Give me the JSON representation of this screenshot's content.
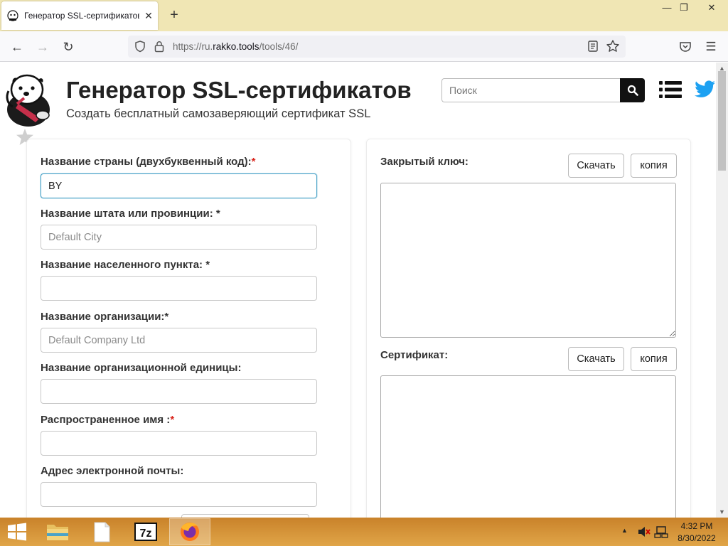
{
  "browser": {
    "tab_title": "Генератор SSL-сертификатов |",
    "url_host_prefix": "https://ru.",
    "url_host": "rakko.tools",
    "url_path": "/tools/46/"
  },
  "header": {
    "title": "Генератор SSL-сертификатов",
    "subtitle": "Создать бесплатный самозаверяющий сертификат SSL",
    "search_placeholder": "Поиск"
  },
  "form": {
    "country_label": "Название страны (двухбуквенный код):",
    "country_value": "BY",
    "state_label": "Название штата или провинции: *",
    "state_placeholder": "Default City",
    "locality_label": "Название населенного пункта: *",
    "org_label": "Название организации:*",
    "org_placeholder": "Default Company Ltd",
    "unit_label": "Название организационной единицы:",
    "cn_label": "Распространенное имя :",
    "email_label": "Адрес электронной почты:",
    "required_mark": "*"
  },
  "keys": {
    "private_key_label": "Закрытый ключ:",
    "certificate_label": "Сертификат:",
    "download_label": "Скачать",
    "copy_label": "копия"
  },
  "taskbar": {
    "time": "4:32 PM",
    "date": "8/30/2022"
  },
  "colors": {
    "tabstrip": "#f0e6b4",
    "taskbar": "#d4943a",
    "required": "#d9251d",
    "focus": "#4aa3c8",
    "twitter": "#1da1f2"
  }
}
